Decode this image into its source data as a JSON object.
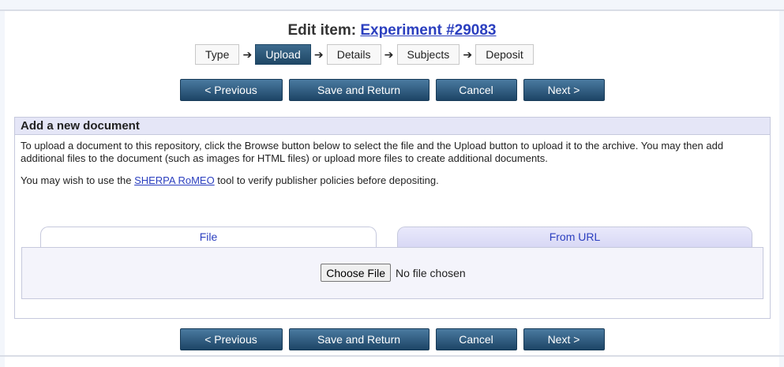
{
  "header": {
    "title_prefix": "Edit item: ",
    "item_link": "Experiment #29083"
  },
  "workflow": {
    "steps": [
      "Type",
      "Upload",
      "Details",
      "Subjects",
      "Deposit"
    ],
    "active_step": "Upload",
    "arrow": "➔"
  },
  "buttons": {
    "previous": "< Previous",
    "save_return": "Save and Return",
    "cancel": "Cancel",
    "next": "Next >"
  },
  "panel": {
    "heading": "Add a new document",
    "intro": "To upload a document to this repository, click the Browse button below to select the file and the Upload button to upload it to the archive. You may then add additional files to the document (such as images for HTML files) or upload more files to create additional documents.",
    "sherpa_prefix": "You may wish to use the ",
    "sherpa_link": "SHERPA RoMEO",
    "sherpa_suffix": " tool to verify publisher policies before depositing."
  },
  "tabs": {
    "file": "File",
    "from_url": "From URL"
  },
  "file_input": {
    "button": "Choose File",
    "status": "No file chosen"
  },
  "colors": {
    "button_top": "#4a7aa0",
    "button_bottom": "#1d4566",
    "link": "#2b3fbf",
    "panel_header": "#e5e6f7"
  }
}
